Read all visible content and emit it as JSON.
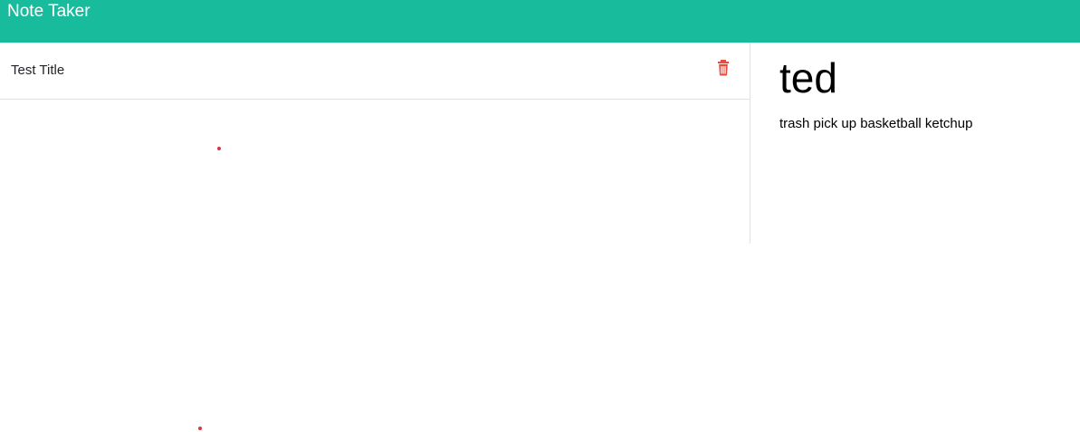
{
  "navbar": {
    "title": "Note Taker",
    "color": "#18bc9c"
  },
  "notes_list": {
    "items": [
      {
        "title": "Test Title",
        "delete_icon": "trash-icon"
      }
    ]
  },
  "active_note": {
    "title": "ted",
    "text": "trash pick up basketball ketchup"
  },
  "colors": {
    "accent": "#18bc9c",
    "danger": "#e74c3c"
  }
}
